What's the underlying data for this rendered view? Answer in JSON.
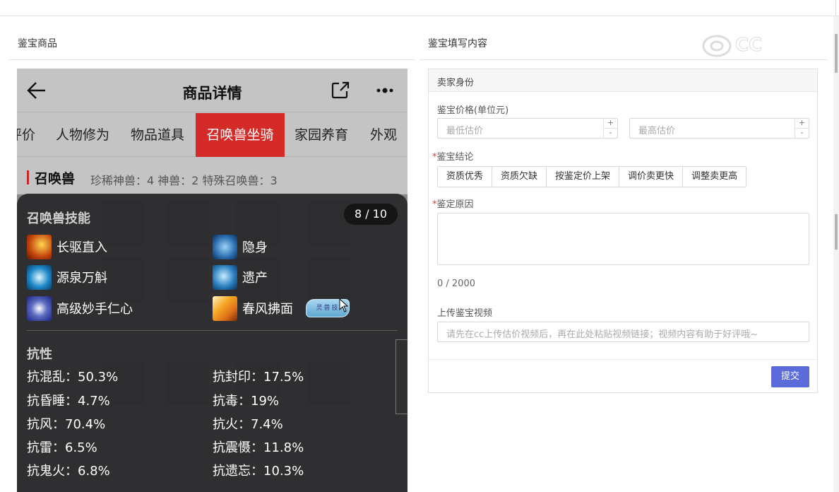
{
  "left_section": {
    "title": "鉴宝商品"
  },
  "right_section": {
    "title": "鉴宝填写内容"
  },
  "watermark": {
    "text": "CC"
  },
  "phone": {
    "header_title": "商品详情",
    "tabs": [
      "评价",
      "人物修为",
      "物品道具",
      "召唤兽坐骑",
      "家园养育",
      "外观"
    ],
    "active_tab": "召唤兽坐骑",
    "pet": {
      "title": "召唤兽",
      "stats": "珍稀神兽：4   神兽：2   特殊召唤兽：3"
    },
    "overlay": {
      "title": "召唤兽技能",
      "pages": "8 / 10",
      "skills": [
        {
          "name": "长驱直入",
          "icon": "charge-skill-icon",
          "color": "#c2410c"
        },
        {
          "name": "隐身",
          "icon": "stealth-skill-icon",
          "color": "#2b6cb0"
        },
        {
          "name": "源泉万斛",
          "icon": "fountain-skill-icon",
          "color": "#1e88c8"
        },
        {
          "name": "遗产",
          "icon": "legacy-skill-icon",
          "color": "#2a7fc0"
        },
        {
          "name": "高级妙手仁心",
          "icon": "healer-skill-icon",
          "color": "#3949ab"
        },
        {
          "name": "春风拂面",
          "icon": "spring-breeze-skill-icon",
          "color": "#e0701a"
        }
      ],
      "badge": "灵兽技",
      "resist_title": "抗性",
      "resists": [
        {
          "label": "抗混乱：50.3%"
        },
        {
          "label": "抗封印：17.5%"
        },
        {
          "label": "抗昏睡：4.7%"
        },
        {
          "label": "抗毒：19%"
        },
        {
          "label": "抗风：70.4%"
        },
        {
          "label": "抗火：7.4%"
        },
        {
          "label": "抗雷：6.5%"
        },
        {
          "label": "抗震慑：11.8%"
        },
        {
          "label": "抗鬼火：6.8%"
        },
        {
          "label": "抗遗忘：10.3%"
        }
      ]
    }
  },
  "form": {
    "card_title": "卖家身份",
    "price_label": "鉴宝价格(单位元)",
    "min_placeholder": "最低估价",
    "max_placeholder": "最高估价",
    "spin_up": "+",
    "spin_down": "-",
    "req_mark": "*",
    "conclusion_label": "鉴宝结论",
    "conclusion_options": [
      "资质优秀",
      "资质欠缺",
      "按鉴定价上架",
      "调价卖更快",
      "调整卖更高"
    ],
    "reason_label": "鉴定原因",
    "reason_count": "0 / 2000",
    "video_label": "上传鉴宝视频",
    "video_placeholder": "请先在cc上传估价视频后，再在此处粘贴视频链接；视频内容有助于好评哦~",
    "submit_label": "提交"
  },
  "colors": {
    "accent": "#5b6bd9",
    "active_tab": "#d42b28",
    "required": "#e53935"
  }
}
